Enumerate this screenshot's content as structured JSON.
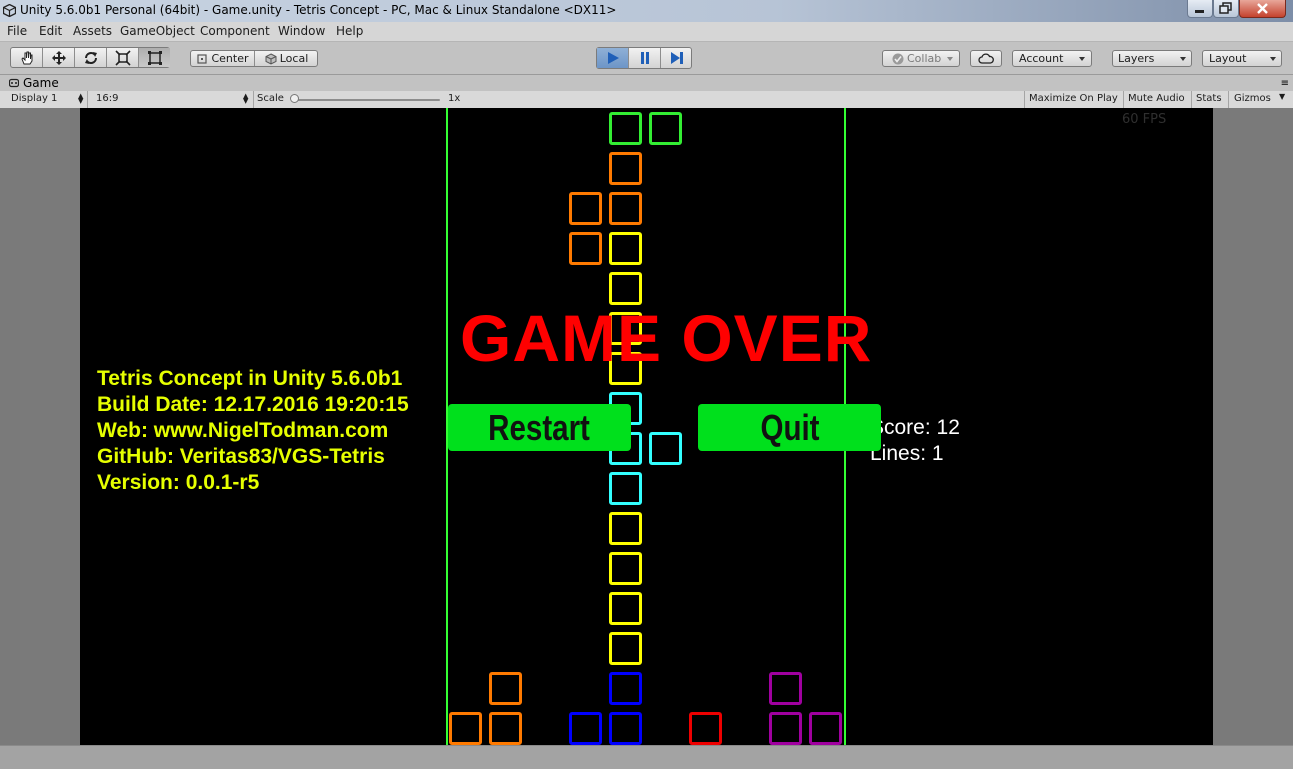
{
  "window": {
    "title": "Unity 5.6.0b1 Personal (64bit) - Game.unity - Tetris Concept - PC, Mac & Linux Standalone <DX11>"
  },
  "menu": [
    "File",
    "Edit",
    "Assets",
    "GameObject",
    "Component",
    "Window",
    "Help"
  ],
  "toolbar": {
    "transform_tools": [
      "hand-icon",
      "move-icon",
      "rotate-icon",
      "scale-icon",
      "rect-icon"
    ],
    "pivot_label": "Center",
    "space_label": "Local",
    "play_icons": [
      "play-icon",
      "pause-icon",
      "step-icon"
    ],
    "collab_label": "Collab",
    "account_label": "Account",
    "layers_label": "Layers",
    "layout_label": "Layout"
  },
  "game_tab": {
    "label": "Game",
    "display": "Display 1",
    "aspect": "16:9",
    "scale_label": "Scale",
    "scale_value": "1x",
    "toggles": [
      "Maximize On Play",
      "Mute Audio",
      "Stats",
      "Gizmos"
    ]
  },
  "game": {
    "fps": "60 FPS",
    "info_lines": [
      "Tetris Concept in Unity 5.6.0b1",
      "Build Date: 12.17.2016 19:20:15",
      "Web: www.NigelTodman.com",
      "GitHub: Veritas83/VGS-Tetris",
      "Version: 0.0.1-r5"
    ],
    "score_text": "Score: 12",
    "lines_text": "Lines: 1",
    "game_over": "GAME OVER",
    "restart_label": "Restart",
    "quit_label": "Quit",
    "colors": {
      "wall": "#33ff33",
      "green": "#33ee33",
      "orange": "#ff7a00",
      "yellow": "#ffff00",
      "cyan": "#33ffff",
      "blue": "#0000ff",
      "red": "#ee0000",
      "purple": "#a000a0"
    }
  }
}
